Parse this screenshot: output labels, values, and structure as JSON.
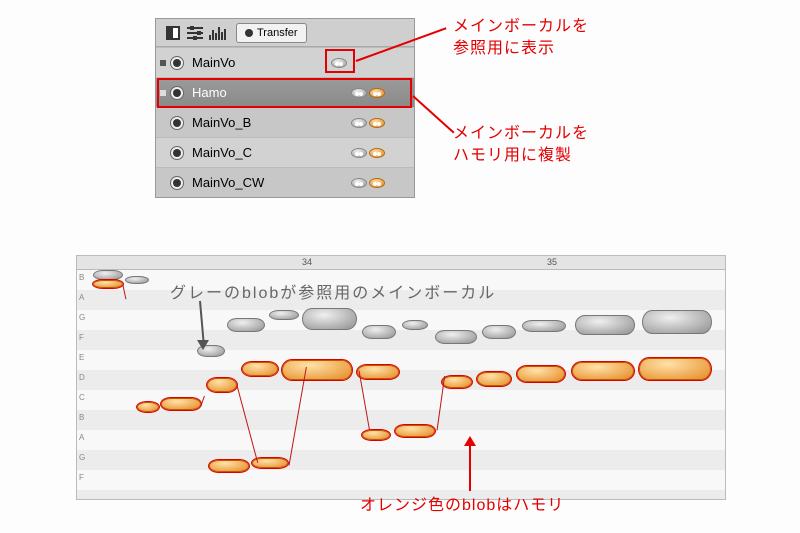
{
  "colors": {
    "anno_red": "#e40000",
    "blob_grey": "#999999",
    "blob_orange": "#e08a30"
  },
  "tracklist": {
    "transfer_label": "Transfer",
    "rows": [
      {
        "name": "MainVo",
        "grey": true,
        "orange": false
      },
      {
        "name": "Hamo",
        "grey": true,
        "orange": true
      },
      {
        "name": "MainVo_B",
        "grey": true,
        "orange": true
      },
      {
        "name": "MainVo_C",
        "grey": true,
        "orange": true
      },
      {
        "name": "MainVo_CW",
        "grey": true,
        "orange": true
      }
    ]
  },
  "annotations": {
    "top_right_1": "メインボーカルを",
    "top_right_2": "参照用に表示",
    "mid_right_1": "メインボーカルを",
    "mid_right_2": "ハモリ用に複製",
    "editor_grey": "グレーのblobが参照用のメインボーカル",
    "editor_orange": "オレンジ色のblobはハモリ"
  },
  "editor": {
    "ruler": {
      "t1": "34",
      "t2": "35"
    },
    "keys": [
      "B",
      "A",
      "G",
      "F",
      "E",
      "D",
      "C",
      "B",
      "A",
      "G",
      "F"
    ]
  }
}
